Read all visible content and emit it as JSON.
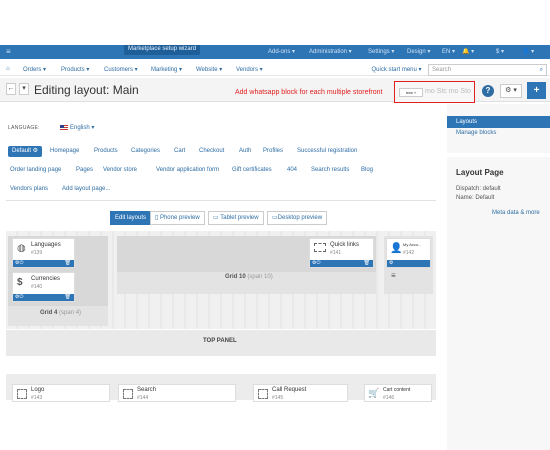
{
  "topbar": {
    "wizard": "Marketplace setup wizard",
    "addons": "Add-ons ▾",
    "administration": "Administration ▾",
    "settings": "Settings ▾",
    "design": "Design ▾",
    "lang": "EN ▾",
    "bell": "🔔 ▾",
    "currency": "$ ▾",
    "user": "👤 ▾"
  },
  "subnav": {
    "orders": "Orders ▾",
    "products": "Products ▾",
    "customers": "Customers ▾",
    "marketing": "Marketing ▾",
    "website": "Website ▾",
    "vendors": "Vendors ▾",
    "quick_start": "Quick start menu ▾",
    "search_placeholder": "Search"
  },
  "header": {
    "title": "Editing layout: Main",
    "annotation": "Add whatsapp block for each multiple storefront",
    "storefront_text": "mo Stc mo Sto"
  },
  "sidebar": {
    "layouts": "Layouts",
    "manage_blocks": "Manage blocks",
    "layout_page_title": "Layout Page",
    "dispatch": "Dispatch: default",
    "name": "Name: Default",
    "more": "Meta data & more"
  },
  "language": {
    "label": "LANGUAGE:",
    "value": "English ▾"
  },
  "tabs_row1": [
    "Default ⚙",
    "Homepage",
    "Products",
    "Categories",
    "Cart",
    "Checkout",
    "Auth",
    "Profiles",
    "Successful registration"
  ],
  "tabs_row2": [
    "Order landing page",
    "Pages",
    "Vendor store",
    "Vendor application form",
    "Gift certificates",
    "404",
    "Search results",
    "Blog"
  ],
  "tabs_row3": [
    "Vendors plans",
    "Add layout page..."
  ],
  "preview": {
    "edit": "Edit layouts",
    "phone": "Phone preview",
    "tablet": "Tablet preview",
    "desktop": "Desktop preview"
  },
  "blocks": {
    "languages": {
      "name": "Languages",
      "id": "#139"
    },
    "currencies": {
      "name": "Currencies",
      "id": "#140"
    },
    "quick_links": {
      "name": "Quick links",
      "id": "#141"
    },
    "my_account": {
      "name": "My Acco...",
      "id": "#142"
    },
    "grid4_main": "Grid 4",
    "grid4_span": "(span 4)",
    "grid10_main": "Grid 10",
    "grid10_span": "(span 10)",
    "top_panel": "TOP PANEL"
  },
  "lower_blocks": [
    {
      "name": "Logo",
      "id": "#143"
    },
    {
      "name": "Search",
      "id": "#144"
    },
    {
      "name": "Call Request",
      "id": "#145"
    },
    {
      "name": "Cart content",
      "id": "#146"
    }
  ]
}
